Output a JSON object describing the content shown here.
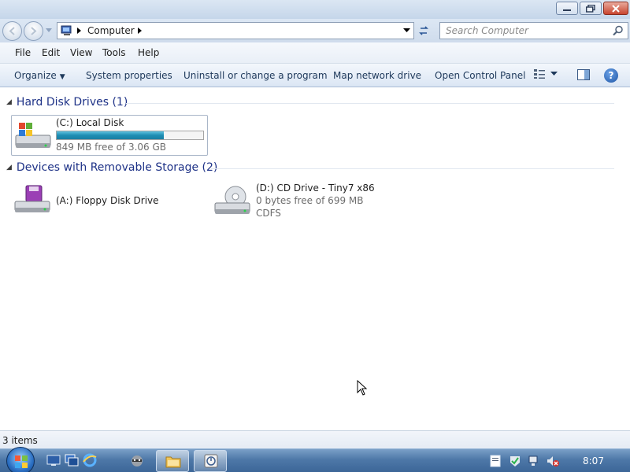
{
  "address": {
    "location": "Computer"
  },
  "search": {
    "placeholder": "Search Computer"
  },
  "menu": [
    "File",
    "Edit",
    "View",
    "Tools",
    "Help"
  ],
  "commands": {
    "organize": "Organize",
    "system_properties": "System properties",
    "uninstall": "Uninstall or change a program",
    "map_drive": "Map network drive",
    "control_panel": "Open Control Panel"
  },
  "groups": {
    "hard_disks": {
      "title": "Hard Disk Drives (1)"
    },
    "removable": {
      "title": "Devices with Removable Storage (2)"
    }
  },
  "drives": {
    "c": {
      "name": "(C:) Local Disk",
      "free_text": "849 MB free of 3.06 GB",
      "used_fraction": 0.73
    },
    "a": {
      "name": "(A:) Floppy Disk Drive"
    },
    "d": {
      "name": "(D:) CD Drive - Tiny7 x86",
      "free_text": "0 bytes free of 699 MB",
      "filesystem": "CDFS"
    }
  },
  "status": {
    "items": "3 items"
  },
  "taskbar": {
    "clock": "8:07"
  },
  "colors": {
    "accent": "#1e3287",
    "usage_fill": "#1f8db3",
    "taskbar": "#4e78a8"
  }
}
